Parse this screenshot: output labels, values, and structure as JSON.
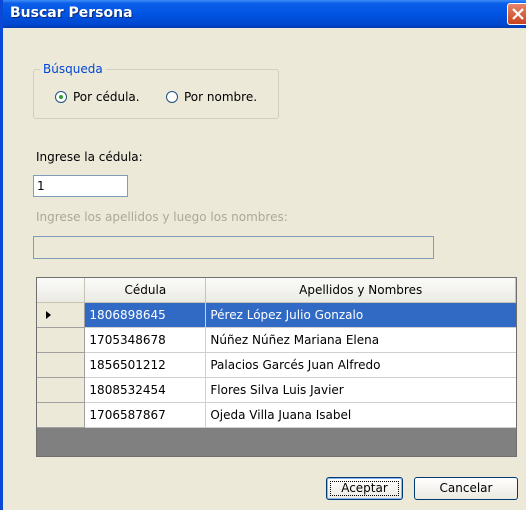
{
  "window": {
    "title": "Buscar Persona"
  },
  "search_group": {
    "label": "Búsqueda",
    "options": [
      {
        "label": "Por cédula.",
        "selected": true
      },
      {
        "label": "Por nombre.",
        "selected": false
      }
    ]
  },
  "cedula": {
    "label": "Ingrese la cédula:",
    "value": "1"
  },
  "names": {
    "label": "Ingrese los apellidos y luego los nombres:",
    "value": ""
  },
  "grid": {
    "columns": [
      "Cédula",
      "Apellidos y Nombres"
    ],
    "rows": [
      {
        "cedula": "1806898645",
        "nombre": "Pérez López Julio Gonzalo",
        "selected": true
      },
      {
        "cedula": "1705348678",
        "nombre": "Núñez Núñez Mariana Elena",
        "selected": false
      },
      {
        "cedula": "1856501212",
        "nombre": "Palacios Garcés Juan Alfredo",
        "selected": false
      },
      {
        "cedula": "1808532454",
        "nombre": "Flores Silva Luis Javier",
        "selected": false
      },
      {
        "cedula": "1706587867",
        "nombre": "Ojeda Villa Juana Isabel",
        "selected": false
      }
    ]
  },
  "buttons": {
    "accept": "Aceptar",
    "cancel": "Cancelar"
  },
  "colors": {
    "titlebar": "#0054e3",
    "selection": "#316ac5",
    "group_label": "#0046d5"
  }
}
